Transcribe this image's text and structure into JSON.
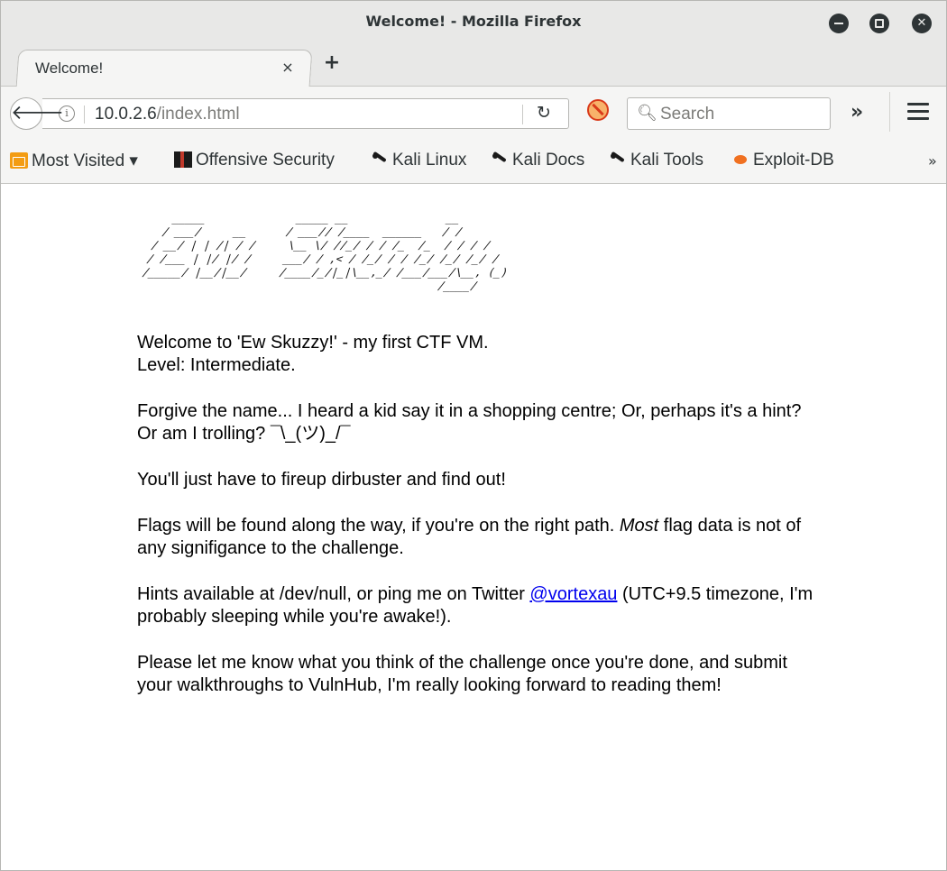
{
  "window": {
    "title": "Welcome! - Mozilla Firefox"
  },
  "tabs": [
    {
      "label": "Welcome!",
      "close": "×"
    }
  ],
  "newtab_label": "+",
  "navbar": {
    "url_host": "10.0.2.6",
    "url_path": "/index.html",
    "search_placeholder": "Search",
    "overflow": "»"
  },
  "bookmarks": [
    {
      "label": "Most Visited ▾",
      "icon": "folder-icon"
    },
    {
      "label": "Offensive Security",
      "icon": "offsec-icon"
    },
    {
      "label": "Kali Linux",
      "icon": "kali-dragon-icon"
    },
    {
      "label": "Kali Docs",
      "icon": "kali-dragon-icon"
    },
    {
      "label": "Kali Tools",
      "icon": "kali-dragon-icon"
    },
    {
      "label": "Exploit-DB",
      "icon": "exploit-db-icon"
    }
  ],
  "bookmarks_more": "»",
  "page": {
    "banner": "  _____              _____ __               __\n / ___/     __      / ___// /____  ______   / /\n/ __/ | | /| / /     \\__ \\/ //_/ / / /_  /_  / / / /\n/ /___ | |/ |/ /     ___/ / ,< / /_/ / / /_/ /_/ /_/ /\n/_____/ |__/|__/     /____/_/|_|\\__,_/ /___/___/\\__, (_)\n                                              /____/",
    "intro_line1": "Welcome to 'Ew Skuzzy!' - my first CTF VM.",
    "intro_line2": "Level: Intermediate.",
    "para_forgive": "Forgive the name... I heard a kid say it in a shopping centre; Or, perhaps it's a hint? Or am I trolling? ¯\\_(ツ)_/¯",
    "para_dirbuster": "You'll just have to fireup dirbuster and find out!",
    "flags_before": "Flags will be found along the way, if you're on the right path. ",
    "flags_em": "Most",
    "flags_after": " flag data is not of any signifigance to the challenge.",
    "hints_before": "Hints available at /dev/null, or ping me on Twitter ",
    "hints_link": "@vortexau",
    "hints_after": " (UTC+9.5 timezone, I'm probably sleeping while you're awake!).",
    "para_feedback": "Please let me know what you think of the challenge once you're done, and submit your walkthroughs to VulnHub, I'm really looking forward to reading them!"
  }
}
